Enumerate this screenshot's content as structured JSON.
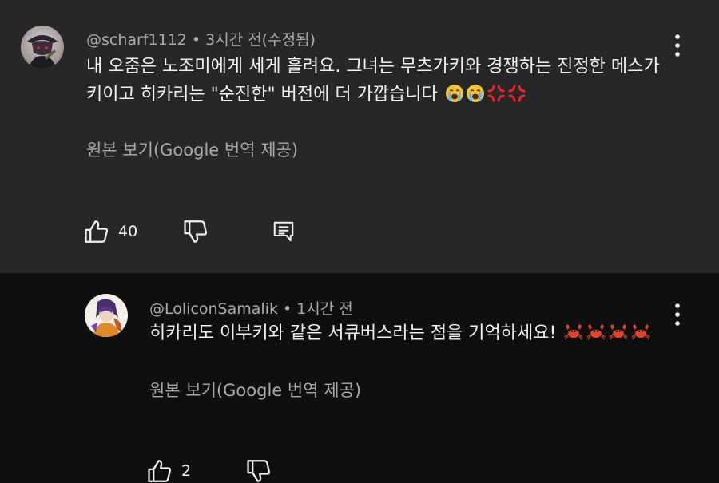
{
  "comments": [
    {
      "author": "@scharf1112",
      "separator": "•",
      "time": "3시간 전(수정됨)",
      "text": "내 오줌은 노조미에게 세게 흘려요. 그녀는 무츠가키와 경쟁하는 진정한 메스가키이고 히카리는 \"순진한\" 버전에 더 가깝습니다",
      "emojis": [
        "crying-face",
        "crying-face",
        "anger-symbol",
        "anger-symbol"
      ],
      "translate_label": "원본 보기(Google 번역 제공)",
      "like_count": "40",
      "actions": [
        "like",
        "dislike",
        "reply"
      ]
    },
    {
      "author": "@LoliconSamalik",
      "separator": "•",
      "time": "1시간 전",
      "text": "히카리도 이부키와 같은 서큐버스라는 점을 기억하세요!",
      "emojis": [
        "crab",
        "crab",
        "crab",
        "crab"
      ],
      "translate_label": "원본 보기(Google 번역 제공)",
      "like_count": "2",
      "actions": [
        "like",
        "dislike"
      ]
    }
  ],
  "colors": {
    "main_bg": "#272727",
    "reply_bg": "#0f0f0f",
    "primary_text": "#f1f1f1",
    "secondary_text": "#aaaaaa"
  }
}
